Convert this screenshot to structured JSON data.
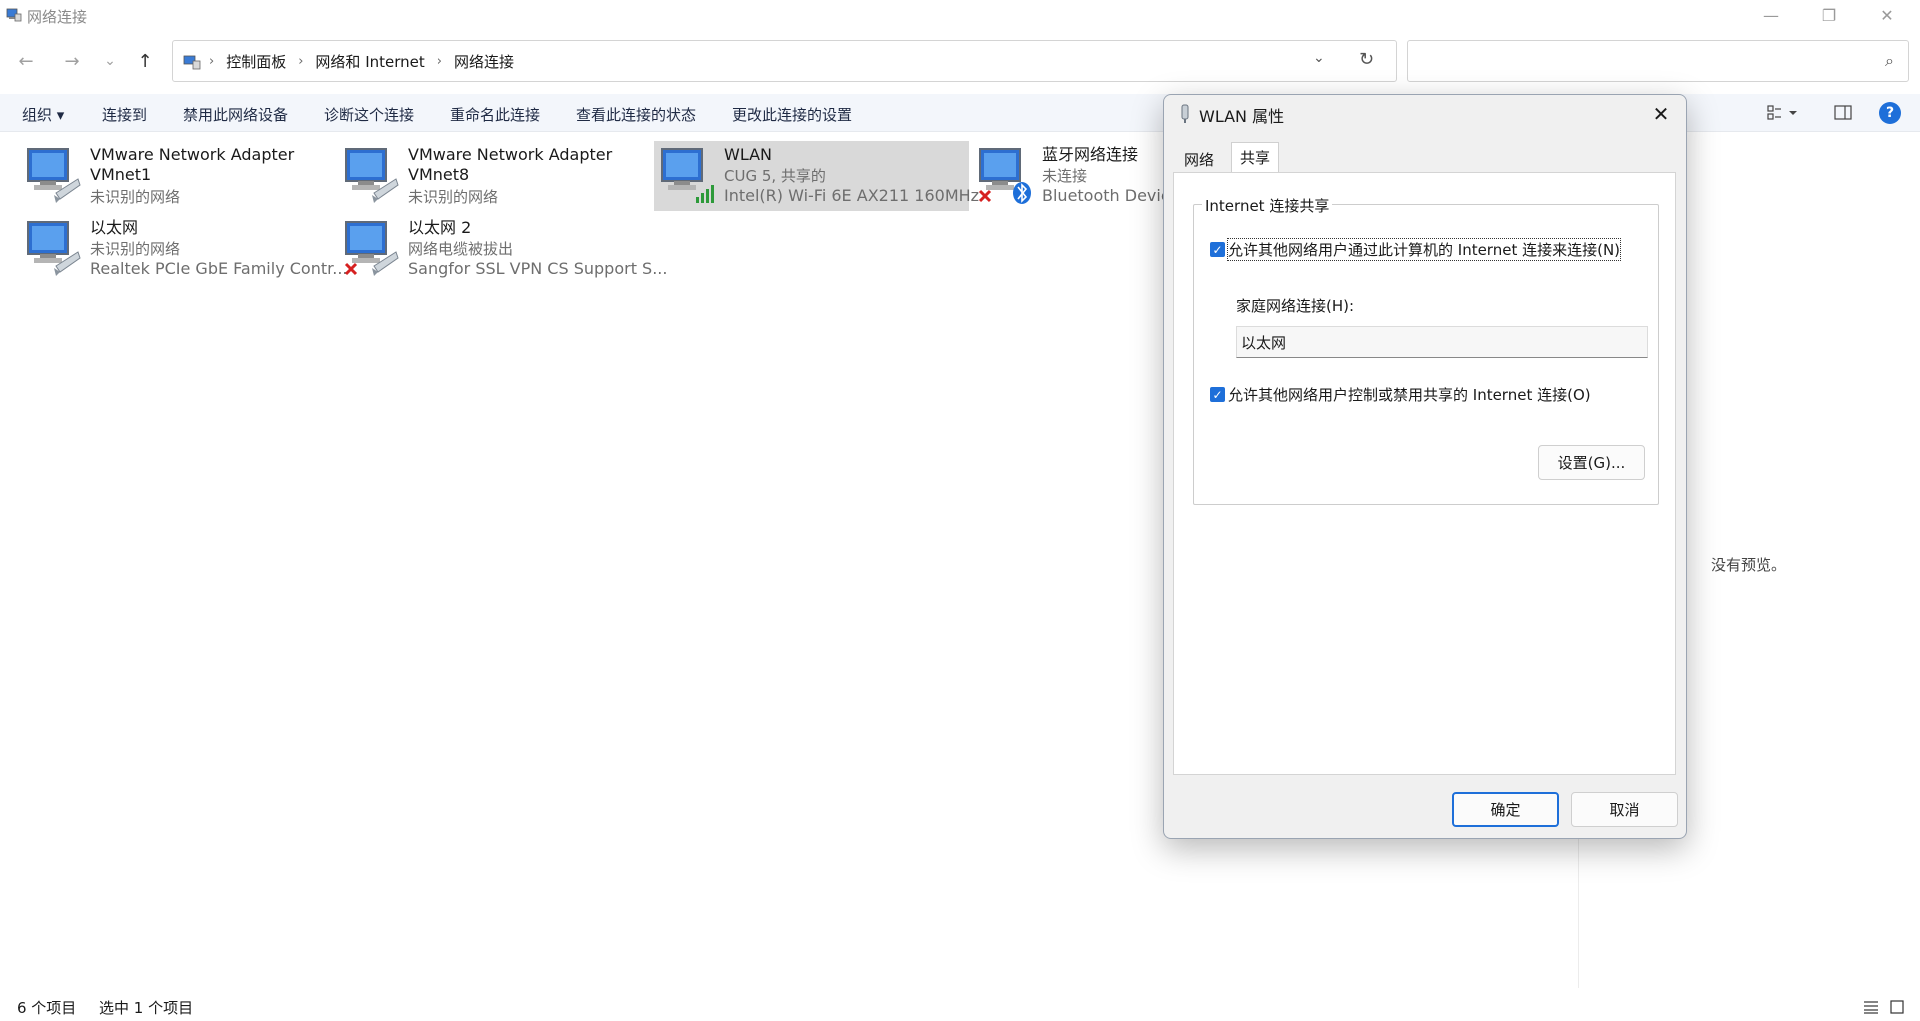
{
  "window": {
    "title": "网络连接",
    "icon": "network-connections-icon",
    "controls": {
      "minimize": "—",
      "restore": "❐",
      "close": "✕"
    }
  },
  "nav": {
    "back": "←",
    "forward": "→",
    "recent": "⌄",
    "up": "↑"
  },
  "address": {
    "crumbs": [
      "控制面板",
      "网络和 Internet",
      "网络连接"
    ],
    "separator": "›",
    "dropdown": "⌄",
    "refresh": "↻"
  },
  "search": {
    "placeholder": "",
    "icon": "⌕"
  },
  "commands": [
    "组织 ▾",
    "连接到",
    "禁用此网络设备",
    "诊断这个连接",
    "重命名此连接",
    "查看此连接的状态",
    "更改此连接的设置"
  ],
  "items": [
    {
      "name": "VMware Network Adapter VMnet1",
      "name_line1": "VMware Network Adapter",
      "name_line2": "VMnet1",
      "status": "未识别的网络",
      "device": "",
      "badge": "none"
    },
    {
      "name": "VMware Network Adapter VMnet8",
      "name_line1": "VMware Network Adapter",
      "name_line2": "VMnet8",
      "status": "未识别的网络",
      "device": "",
      "badge": "none"
    },
    {
      "name": "WLAN",
      "status": "CUG 5, 共享的",
      "device": "Intel(R) Wi-Fi 6E AX211 160MHz",
      "badge": "wifi",
      "selected": true
    },
    {
      "name": "蓝牙网络连接",
      "status": "未连接",
      "device": "Bluetooth Device",
      "badge": "bluetooth"
    },
    {
      "name": "以太网",
      "status": "未识别的网络",
      "device": "Realtek PCIe GbE Family Contr...",
      "badge": "none"
    },
    {
      "name": "以太网 2",
      "status": "网络电缆被拔出",
      "device": "Sangfor SSL VPN CS Support S...",
      "badge": "error"
    }
  ],
  "preview": {
    "text": "没有预览。"
  },
  "statusbar": {
    "count": "6 个项目",
    "selected": "选中 1 个项目"
  },
  "dialog": {
    "title": "WLAN 属性",
    "close": "✕",
    "tabs": [
      "网络",
      "共享"
    ],
    "active_tab": "共享",
    "group_title": "Internet 连接共享",
    "allow_share": {
      "label": "允许其他网络用户通过此计算机的 Internet 连接来连接(N)",
      "checked": true
    },
    "home_label": "家庭网络连接(H):",
    "home_value": "以太网",
    "allow_control": {
      "label": "允许其他网络用户控制或禁用共享的 Internet 连接(O)",
      "checked": true
    },
    "settings_button": "设置(G)...",
    "ok": "确定",
    "cancel": "取消"
  },
  "colors": {
    "accent": "#1e6fd9",
    "selection": "#d9d9d9",
    "commandbar": "#f3f6fb"
  }
}
